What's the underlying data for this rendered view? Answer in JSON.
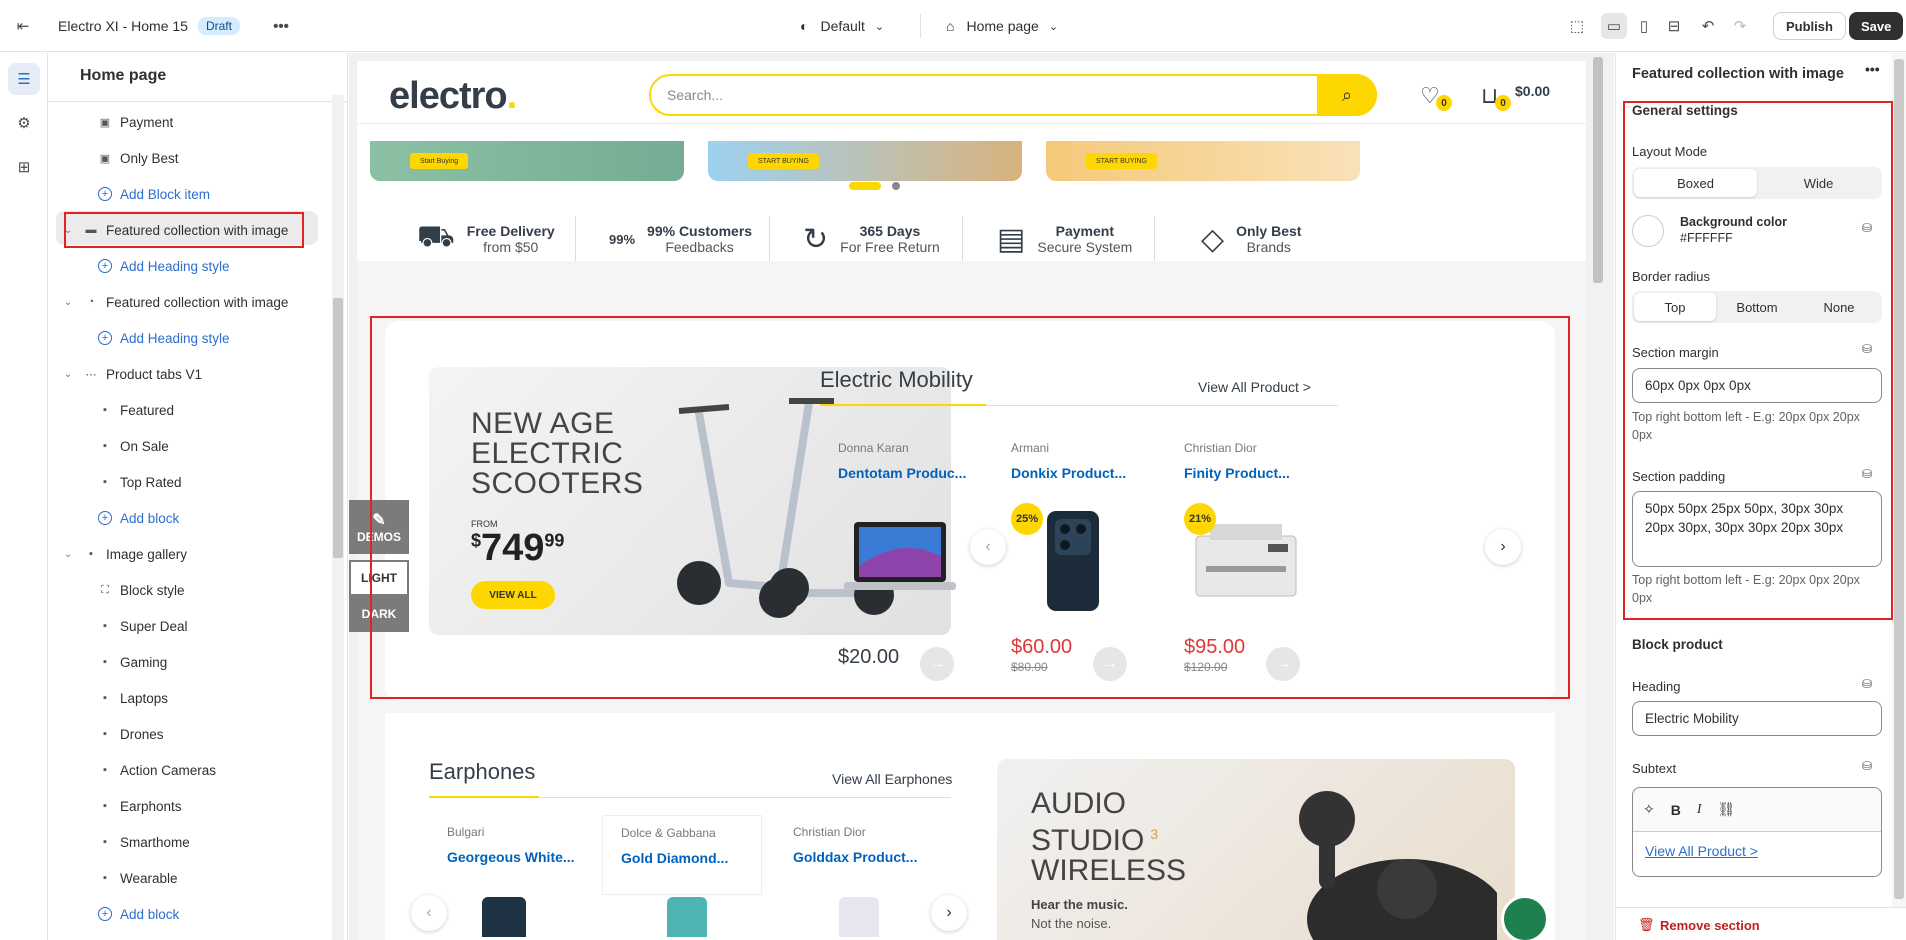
{
  "topbar": {
    "theme_name": "Electro XI - Home 15",
    "status_badge": "Draft",
    "more_label": "•••",
    "preset_label": "Default",
    "page_label": "Home page",
    "publish_label": "Publish",
    "save_label": "Save"
  },
  "left_panel": {
    "title": "Home page",
    "items": [
      {
        "label": "Payment",
        "icon": "image-icon"
      },
      {
        "label": "Only Best",
        "icon": "image-icon"
      },
      {
        "label": "Add Block item",
        "icon": "add-icon"
      },
      {
        "label": "Featured collection with image",
        "icon": "scooter-icon"
      },
      {
        "label": "Add Heading style",
        "icon": "add-icon"
      },
      {
        "label": "Featured collection with image",
        "icon": "earbuds-icon"
      },
      {
        "label": "Add Heading style",
        "icon": "add-icon"
      },
      {
        "label": "Product tabs V1",
        "icon": "tabs-icon"
      },
      {
        "label": "Featured",
        "icon": "tab-icon"
      },
      {
        "label": "On Sale",
        "icon": "tab-icon"
      },
      {
        "label": "Top Rated",
        "icon": "tab-icon"
      },
      {
        "label": "Add block",
        "icon": "add-icon"
      },
      {
        "label": "Image gallery",
        "icon": "gallery-icon"
      },
      {
        "label": "Block style",
        "icon": "block-style-icon"
      },
      {
        "label": "Super Deal",
        "icon": "tab-icon"
      },
      {
        "label": "Gaming",
        "icon": "tab-icon"
      },
      {
        "label": "Laptops",
        "icon": "tab-icon"
      },
      {
        "label": "Drones",
        "icon": "tab-icon"
      },
      {
        "label": "Action Cameras",
        "icon": "tab-icon"
      },
      {
        "label": "Earphonts",
        "icon": "tab-icon"
      },
      {
        "label": "Smarthome",
        "icon": "tab-icon"
      },
      {
        "label": "Wearable",
        "icon": "tab-icon"
      },
      {
        "label": "Add block",
        "icon": "add-icon"
      }
    ]
  },
  "site": {
    "logo": "electro",
    "search_placeholder": "Search...",
    "wishlist_count": "0",
    "cart_count": "0",
    "cart_total": "$0.00",
    "banner_buttons": [
      "Start Buying",
      "START BUYING",
      "START BUYING"
    ],
    "features": [
      {
        "title": "Free Delivery",
        "sub": "from $50"
      },
      {
        "title": "99% Customers",
        "sub": "Feedbacks",
        "icon_text": "99%"
      },
      {
        "title": "365 Days",
        "sub": "For Free Return"
      },
      {
        "title": "Payment",
        "sub": "Secure System"
      },
      {
        "title": "Only Best",
        "sub": "Brands"
      }
    ],
    "promo": {
      "headline_1": "NEW AGE",
      "headline_2": "ELECTRIC",
      "headline_3": "SCOOTERS",
      "from": "FROM",
      "price_symbol": "$",
      "price_main": "749",
      "price_cents": "99",
      "button": "VIEW ALL"
    },
    "collection": {
      "heading": "Electric Mobility",
      "link": "View All Product >",
      "products": [
        {
          "brand": "Donna Karan",
          "name": "Dentotam Produc...",
          "price": "$20.00",
          "old": "",
          "sale": ""
        },
        {
          "brand": "Armani",
          "name": "Donkix Product...",
          "price": "$60.00",
          "old": "$80.00",
          "sale": "25%"
        },
        {
          "brand": "Christian Dior",
          "name": "Finity Product...",
          "price": "$95.00",
          "old": "$120.00",
          "sale": "21%"
        }
      ]
    },
    "side_tabs": {
      "demos": "DEMOS",
      "light": "LIGHT",
      "dark": "DARK"
    },
    "earphones": {
      "heading": "Earphones",
      "link": "View All Earphones",
      "products": [
        {
          "brand": "Bulgari",
          "name": "Georgeous White..."
        },
        {
          "brand": "Dolce & Gabbana",
          "name": "Gold Diamond..."
        },
        {
          "brand": "Christian Dior",
          "name": "Golddax Product..."
        }
      ],
      "promo_1": "AUDIO",
      "promo_2": "STUDIO",
      "promo_sup": "3",
      "promo_3": "WIRELESS",
      "promo_tag_1": "Hear the music.",
      "promo_tag_2": "Not the noise."
    }
  },
  "right_panel": {
    "title": "Featured collection with image",
    "general_settings": "General settings",
    "layout_mode_label": "Layout Mode",
    "layout_modes": [
      "Boxed",
      "Wide"
    ],
    "bg_color_label": "Background color",
    "bg_color_value": "#FFFFFF",
    "border_radius_label": "Border radius",
    "border_radius_opts": [
      "Top",
      "Bottom",
      "None"
    ],
    "margin_label": "Section margin",
    "margin_value": "60px 0px 0px 0px",
    "margin_help": "Top right bottom left - E.g: 20px 0px 20px 0px",
    "padding_label": "Section padding",
    "padding_value": "50px 50px 25px 50px, 30px 30px 20px 30px, 30px 30px 20px 30px",
    "padding_help": "Top right bottom left - E.g: 20px 0px 20px 0px",
    "block_product": "Block product",
    "heading_label": "Heading",
    "heading_value": "Electric Mobility",
    "subtext_label": "Subtext",
    "subtext_value": "View All Product >",
    "remove_label": "Remove section"
  },
  "colors": {
    "accent_yellow": "#fed700",
    "highlight_red": "#e02424",
    "link_blue": "#0062bd",
    "sale_red": "#df3737"
  }
}
